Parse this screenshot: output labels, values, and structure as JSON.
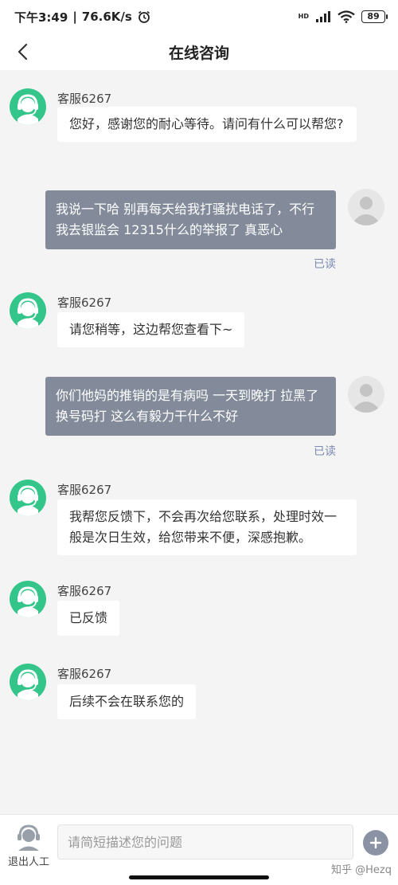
{
  "status_bar": {
    "time": "下午3:49",
    "network_speed": "76.6K/s",
    "hd_label": "HD",
    "battery": "89"
  },
  "header": {
    "title": "在线咨询"
  },
  "chat": {
    "agent_name": "客服6267",
    "read_label": "已读",
    "messages": [
      {
        "sender": "agent",
        "name": "客服6267",
        "text": "您好，感谢您的耐心等待。请问有什么可以帮您?"
      },
      {
        "sender": "user",
        "text": "我说一下哈 别再每天给我打骚扰电话了，不行我去银监会 12315什么的举报了 真恶心",
        "status": "已读"
      },
      {
        "sender": "agent",
        "name": "客服6267",
        "text": "请您稍等，这边帮您查看下~"
      },
      {
        "sender": "user",
        "text": "你们他妈的推销的是有病吗 一天到晚打 拉黑了换号码打 这么有毅力干什么不好",
        "status": "已读"
      },
      {
        "sender": "agent",
        "name": "客服6267",
        "text": "我帮您反馈下，不会再次给您联系，处理时效一般是次日生效，给您带来不便，深感抱歉。"
      },
      {
        "sender": "agent",
        "name": "客服6267",
        "text": "已反馈"
      },
      {
        "sender": "agent",
        "name": "客服6267",
        "text": "后续不会在联系您的"
      }
    ]
  },
  "input_bar": {
    "exit_label": "退出人工",
    "input_value": "",
    "placeholder": "请简短描述您的问题",
    "watermark": "知乎 @Hezq"
  },
  "colors": {
    "agent_avatar": "#33c589",
    "user_bubble": "#838b9b",
    "read_label": "#7a8ab0",
    "background": "#f4f4f4"
  },
  "icons": [
    "back-chevron-icon",
    "headset-agent-icon",
    "user-avatar-icon",
    "signal-icon",
    "wifi-icon",
    "alarm-icon",
    "plus-icon"
  ]
}
